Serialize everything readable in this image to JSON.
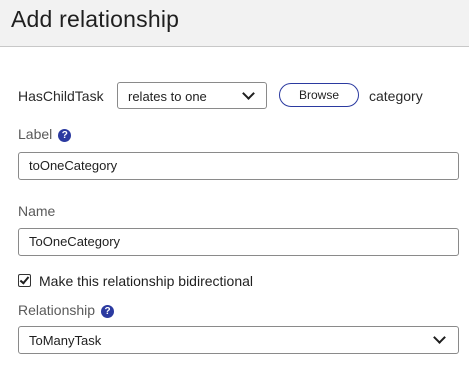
{
  "dialog": {
    "title": "Add relationship"
  },
  "relationship_row": {
    "source_name": "HasChildTask",
    "cardinality_value": "relates to one",
    "browse_label": "Browse",
    "target_name": "category"
  },
  "label_field": {
    "label": "Label",
    "value": "toOneCategory",
    "help_icon": "question-circle"
  },
  "name_field": {
    "label": "Name",
    "value": "ToOneCategory"
  },
  "bidirectional": {
    "label": "Make this relationship bidirectional",
    "checked": true
  },
  "inverse_field": {
    "label": "Relationship",
    "value": "ToManyTask",
    "help_icon": "question-circle"
  },
  "colors": {
    "accent": "#2b3aa0",
    "header_bg": "#f2f2f2"
  }
}
